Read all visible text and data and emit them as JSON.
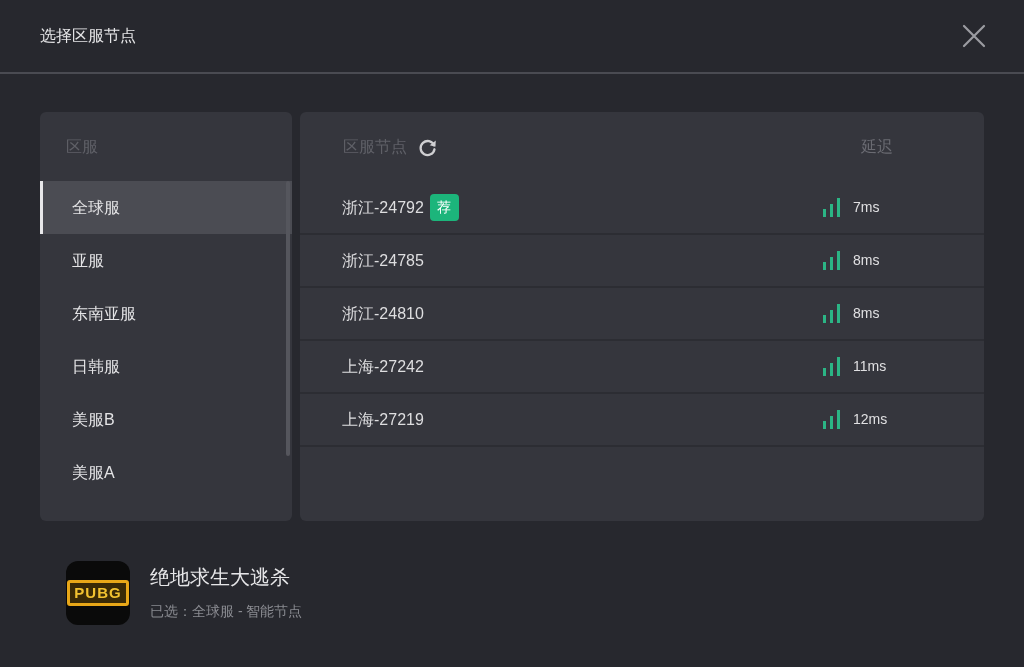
{
  "dialog": {
    "title": "选择区服节点"
  },
  "regions": {
    "heading": "区服",
    "items": [
      {
        "label": "全球服",
        "selected": true
      },
      {
        "label": "亚服",
        "selected": false
      },
      {
        "label": "东南亚服",
        "selected": false
      },
      {
        "label": "日韩服",
        "selected": false
      },
      {
        "label": "美服B",
        "selected": false
      },
      {
        "label": "美服A",
        "selected": false
      }
    ]
  },
  "nodes": {
    "heading": "区服节点",
    "latency_heading": "延迟",
    "rows": [
      {
        "name": "浙江-24792",
        "badge": "荐",
        "latency": "7ms"
      },
      {
        "name": "浙江-24785",
        "latency": "8ms"
      },
      {
        "name": "浙江-24810",
        "latency": "8ms"
      },
      {
        "name": "上海-27242",
        "latency": "11ms"
      },
      {
        "name": "上海-27219",
        "latency": "12ms"
      }
    ]
  },
  "game": {
    "logo_text": "PUBG",
    "title": "绝地求生大逃杀",
    "selection": "已选：全球服 - 智能节点"
  }
}
